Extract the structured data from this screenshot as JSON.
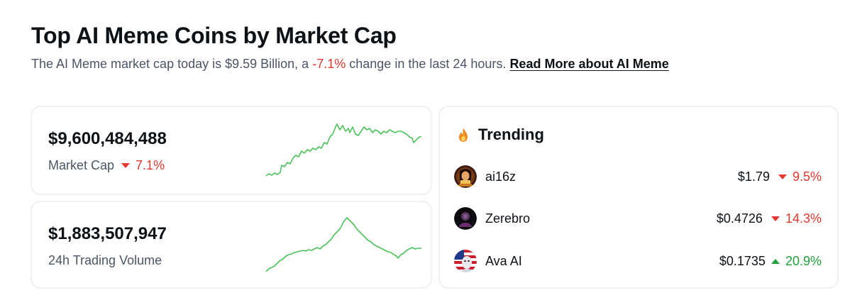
{
  "header": {
    "title": "Top AI Meme Coins by Market Cap",
    "subtitle_prefix": "The AI Meme market cap today is $9.59 Billion, a",
    "subtitle_change": "-7.1%",
    "subtitle_suffix": "change in the last 24 hours.",
    "read_more": "Read More about AI Meme"
  },
  "market_cap": {
    "value": "$9,600,484,488",
    "label": "Market Cap",
    "change": "7.1%",
    "direction": "down"
  },
  "volume": {
    "value": "$1,883,507,947",
    "label": "24h Trading Volume"
  },
  "trending": {
    "title": "Trending",
    "icon": "fire-icon",
    "items": [
      {
        "name": "ai16z",
        "price": "$1.79",
        "change": "9.5%",
        "direction": "down",
        "avatar": "ai16z-avatar"
      },
      {
        "name": "Zerebro",
        "price": "$0.4726",
        "change": "14.3%",
        "direction": "down",
        "avatar": "zerebro-avatar"
      },
      {
        "name": "Ava AI",
        "price": "$0.1735",
        "change": "20.9%",
        "direction": "up",
        "avatar": "ava-ai-avatar"
      }
    ]
  },
  "colors": {
    "negative": "#e5372d",
    "positive": "#20a13a",
    "sparkline": "#4cc25a"
  }
}
